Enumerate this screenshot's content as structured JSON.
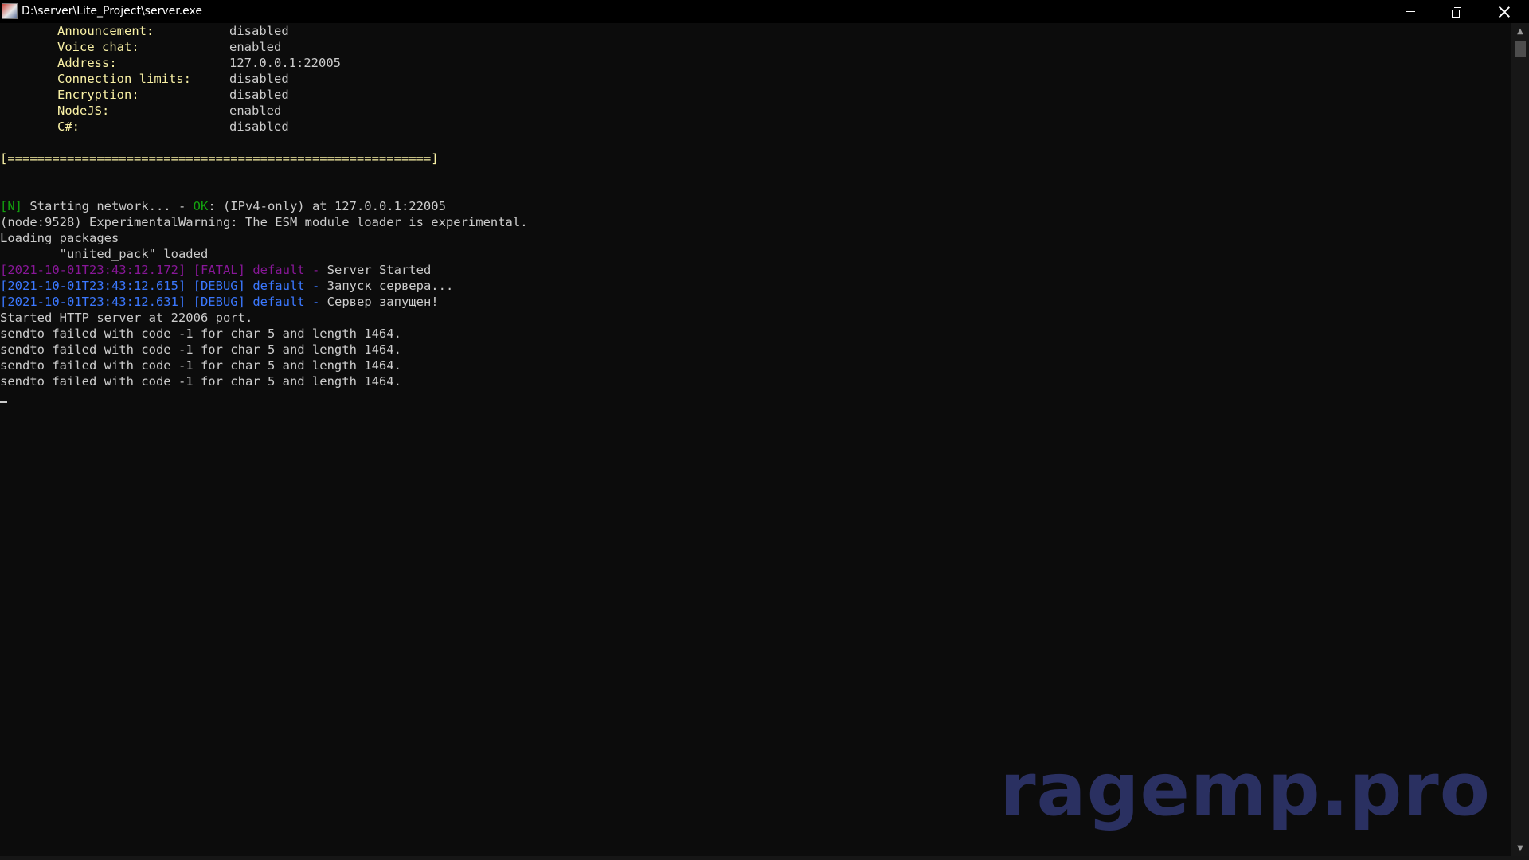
{
  "window": {
    "title": "D:\\server\\Lite_Project\\server.exe",
    "icon": "server-exe-app-icon"
  },
  "config": [
    {
      "key": "Announcement:",
      "value": "disabled"
    },
    {
      "key": "Voice chat:",
      "value": "enabled"
    },
    {
      "key": "Address:",
      "value": "127.0.0.1:22005"
    },
    {
      "key": "Connection limits:",
      "value": "disabled"
    },
    {
      "key": "Encryption:",
      "value": "disabled"
    },
    {
      "key": "NodeJS:",
      "value": "enabled"
    },
    {
      "key": "C#:",
      "value": "disabled"
    }
  ],
  "separator": "[=========================================================]",
  "network": {
    "tag": "[N]",
    "text1": " Starting network... - ",
    "ok": "OK",
    "text2": ": (IPv4-only) at 127.0.0.1:22005"
  },
  "node_warning": "(node:9528) ExperimentalWarning: The ESM module loader is experimental.",
  "loading_packages": "Loading packages",
  "package_loaded": "        \"united_pack\" loaded",
  "logs": [
    {
      "timestamp": "[2021-10-01T23:43:12.172]",
      "level": "[FATAL]",
      "source": "default -",
      "message": "Server Started"
    },
    {
      "timestamp": "[2021-10-01T23:43:12.615]",
      "level": "[DEBUG]",
      "source": "default -",
      "message": "Запуск сервера..."
    },
    {
      "timestamp": "[2021-10-01T23:43:12.631]",
      "level": "[DEBUG]",
      "source": "default -",
      "message": "Сервер запущен!"
    }
  ],
  "http_started": "Started HTTP server at 22006 port.",
  "sendto_errors": [
    "sendto failed with code -1 for char 5 and length 1464.",
    "sendto failed with code -1 for char 5 and length 1464.",
    "sendto failed with code -1 for char 5 and length 1464.",
    "sendto failed with code -1 for char 5 and length 1464."
  ],
  "watermark": "ragemp.pro",
  "colors": {
    "background": "#0c0c0c",
    "default_text": "#cccccc",
    "config_key": "#f9f1a5",
    "network_tag": "#13a10e",
    "fatal": "#881798",
    "debug": "#3b78ff",
    "watermark": "#2c3266"
  }
}
